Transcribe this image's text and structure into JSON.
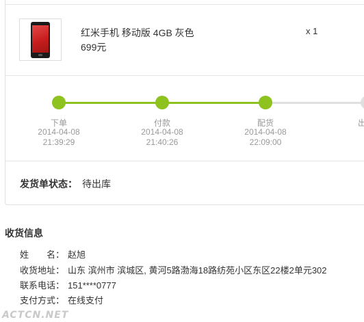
{
  "product": {
    "name": "红米手机 移动版 4GB 灰色",
    "price": "699元",
    "quantity": "x 1"
  },
  "steps": [
    {
      "label": "下单",
      "date": "2014-04-08",
      "time": "21:39:29",
      "done": true
    },
    {
      "label": "付款",
      "date": "2014-04-08",
      "time": "21:40:26",
      "done": true
    },
    {
      "label": "配货",
      "date": "2014-04-08",
      "time": "22:09:00",
      "done": true
    },
    {
      "label": "出",
      "date": "",
      "time": "",
      "done": false
    }
  ],
  "shipment_status": {
    "label": "发货单状态：",
    "value": "待出库"
  },
  "receiver": {
    "title": "收货信息",
    "name_key": "姓　　名：",
    "name_value": "赵旭",
    "address_key": "收货地址：",
    "address_value": "山东 滨州市 滨城区, 黄河5路渤海18路纺苑小区东区22楼2单元302",
    "phone_key": "联系电话：",
    "phone_value": "151****0777",
    "payment_key": "支付方式：",
    "payment_value": "在线支付"
  },
  "watermark": "ACTCN.NET",
  "colors": {
    "progress_done": "#8dc21f",
    "progress_todo": "#e0e0e0"
  }
}
